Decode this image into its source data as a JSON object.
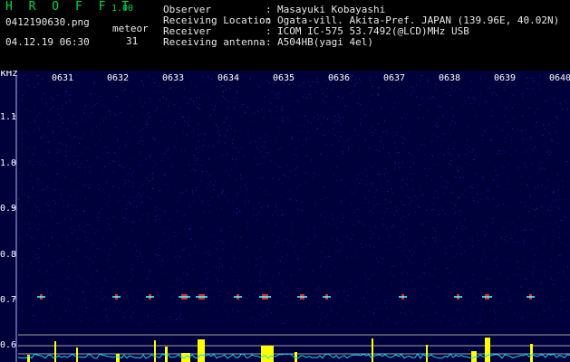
{
  "app": {
    "title": "H R O F F T",
    "version": "1.00"
  },
  "file": {
    "name": "0412190630.png",
    "datetime": "04.12.19 06:30"
  },
  "meteor": {
    "label": "meteor",
    "count": "31"
  },
  "info": [
    {
      "label": "Observer",
      "value": "Masayuki Kobayashi"
    },
    {
      "label": "Receiving Location",
      "value": "Ogata-vill. Akita-Pref. JAPAN (139.96E, 40.02N)"
    },
    {
      "label": "Receiver",
      "value": "ICOM IC-575 53.7492(@LCD)MHz USB"
    },
    {
      "label": "Receiving antenna",
      "value": "A504HB(yagi 4el)"
    }
  ],
  "separator": ":",
  "spectrogram": {
    "unit": "kHz",
    "time_ticks": [
      "0631",
      "0632",
      "0633",
      "0634",
      "0635",
      "0636",
      "0637",
      "0638",
      "0639",
      "0640"
    ],
    "freq_ticks": [
      "1.1",
      "1.0",
      "0.9",
      "0.8",
      "0.7",
      "0.6"
    ],
    "colors": {
      "background": "#00003a",
      "noise": "#2a2ad8",
      "axis": "#b0b0ff",
      "signal": "#ffff00",
      "trace": "#00e0ff"
    }
  }
}
